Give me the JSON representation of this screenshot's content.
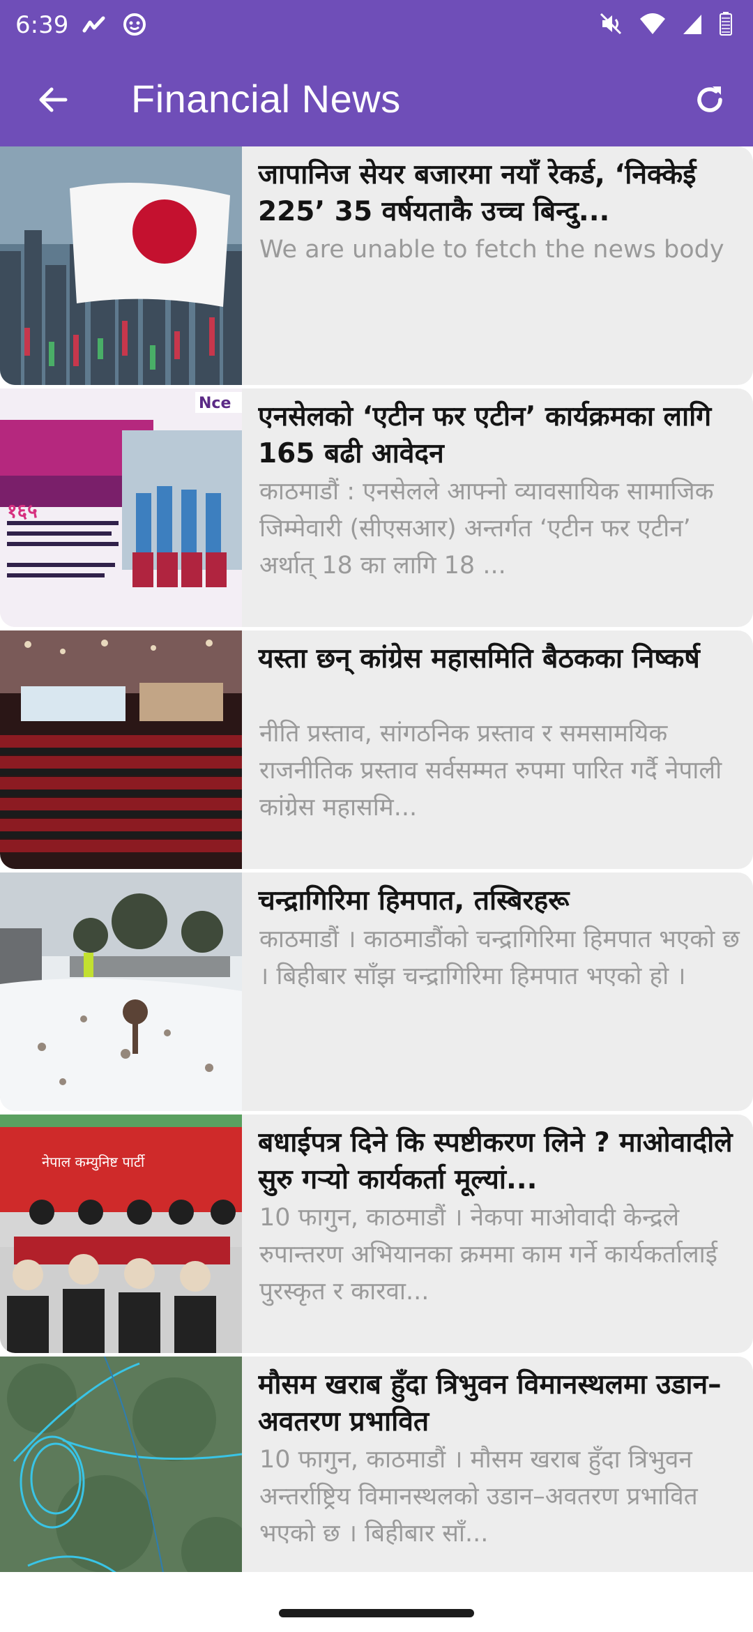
{
  "status_bar": {
    "time": "6:39",
    "left_icons": [
      "trend-icon",
      "emoji-icon"
    ],
    "right_icons": [
      "mute-icon",
      "wifi-icon",
      "signal-icon",
      "battery-icon"
    ]
  },
  "app_bar": {
    "title": "Financial News",
    "back_icon": "arrow-left-icon",
    "refresh_icon": "refresh-icon",
    "color": "#6f4eb8"
  },
  "news": [
    {
      "title": "जापानिज सेयर बजारमा नयाँ रेकर्ड, ‘निक्केई 225’ 35 वर्षयताकै उच्च बिन्दु...",
      "body": "We are unable to fetch the news body",
      "image": "japan-flag-city-image"
    },
    {
      "title": "एनसेलको ‘एटीन फर एटीन’ कार्यक्रमका लागि 165 बढी आवेदन",
      "body": "काठमाडौं : एनसेलले आफ्नो व्यावसायिक सामाजिक जिम्मेवारी (सीएसआर) अन्तर्गत ‘एटीन फर एटीन’ अर्थात् 18 का लागि 18 ...",
      "image": "ncell-community-image"
    },
    {
      "title": "यस्ता छन् कांग्रेस महासमिति बैठकका निष्कर्ष",
      "body": "नीति प्रस्ताव, सांगठनिक प्रस्ताव र समसामयिक राजनीतिक प्रस्ताव सर्वसम्मत रुपमा पारित गर्दै नेपाली कांग्रेस महासमि...",
      "image": "congress-hall-image"
    },
    {
      "title": "चन्द्रागिरिमा हिमपात, तस्बिरहरू",
      "body": "काठमाडौं । काठमाडौंको चन्द्रागिरिमा हिमपात भएको छ । बिहीबार साँझ चन्द्रागिरिमा हिमपात भएको हो ।",
      "image": "snowfall-image"
    },
    {
      "title": "बधाईपत्र दिने कि स्पष्टीकरण लिने ? माओवादीले सुरु गर्‍यो कार्यकर्ता मूल्यां...",
      "body": "10 फागुन, काठमाडौं । नेकपा माओवादी केन्द्रले रुपान्तरण अभियानका क्रममा काम गर्ने कार्यकर्तालाई पुरस्कृत र कारवा...",
      "image": "maoist-meeting-image"
    },
    {
      "title": "मौसम खराब हुँदा त्रिभुवन विमानस्थलमा उडान–अवतरण प्रभावित",
      "body": "10 फागुन, काठमाडौं । मौसम खराब हुँदा त्रिभुवन अन्तर्राष्ट्रिय विमानस्थलको उडान–अवतरण प्रभावित भएको छ । बिहीबार साँ...",
      "image": "flight-map-image"
    }
  ]
}
